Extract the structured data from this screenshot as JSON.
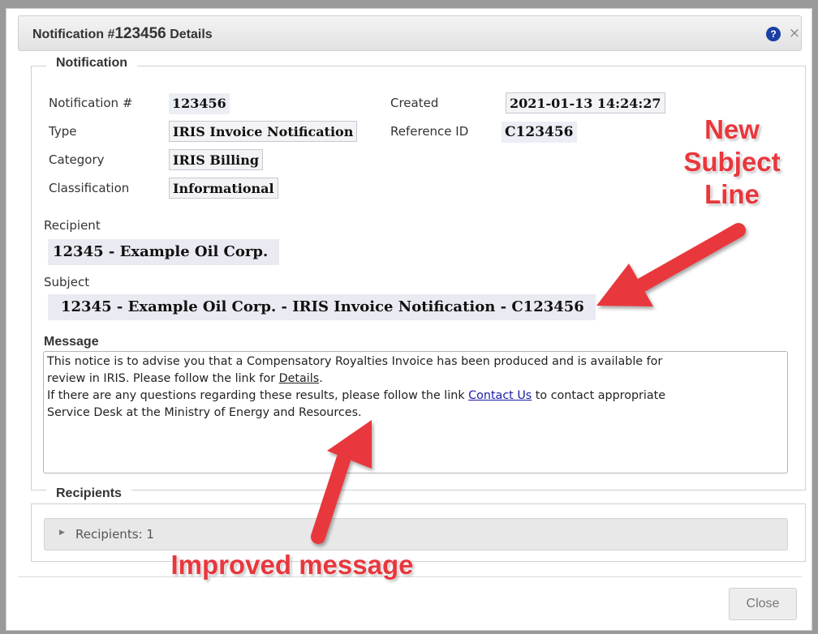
{
  "dialog": {
    "title_prefix": "Notification #",
    "title_number": "123456",
    "title_suffix": " Details",
    "help_icon": "?",
    "close_icon": "×"
  },
  "notification": {
    "legend": "Notification",
    "fields": {
      "number": {
        "label": "Notification #",
        "value": "123456"
      },
      "type": {
        "label": "Type",
        "value": "IRIS Invoice Notification"
      },
      "category": {
        "label": "Category",
        "value": "IRIS Billing"
      },
      "classification": {
        "label": "Classification",
        "value": "Informational"
      },
      "created": {
        "label": "Created",
        "value": "2021-01-13 14:24:27"
      },
      "reference": {
        "label": "Reference ID",
        "value": "C123456"
      }
    },
    "recipient": {
      "label": "Recipient",
      "value": "12345 - Example Oil Corp."
    },
    "subject": {
      "label": "Subject",
      "value": "12345 - Example Oil Corp. - IRIS Invoice Notification - C123456"
    },
    "message": {
      "label": "Message",
      "line1": "This notice is to advise you that a Compensatory Royalties Invoice has been produced and is available for",
      "line2_pre": "review in IRIS. Please follow the link for ",
      "line2_link": "Details",
      "line2_post": ".",
      "line3_pre": "If there are any questions regarding these results, please follow the link ",
      "line3_link": "Contact Us",
      "line3_post": " to contact appropriate",
      "line4": "Service Desk at the Ministry of Energy and Resources."
    }
  },
  "recipients": {
    "legend": "Recipients",
    "accordion_label": "Recipients: 1"
  },
  "footer": {
    "close_label": "Close"
  },
  "annotations": {
    "subject_callout": [
      "New",
      "Subject",
      "Line"
    ],
    "message_callout": "Improved message",
    "color": "#e8373d"
  }
}
